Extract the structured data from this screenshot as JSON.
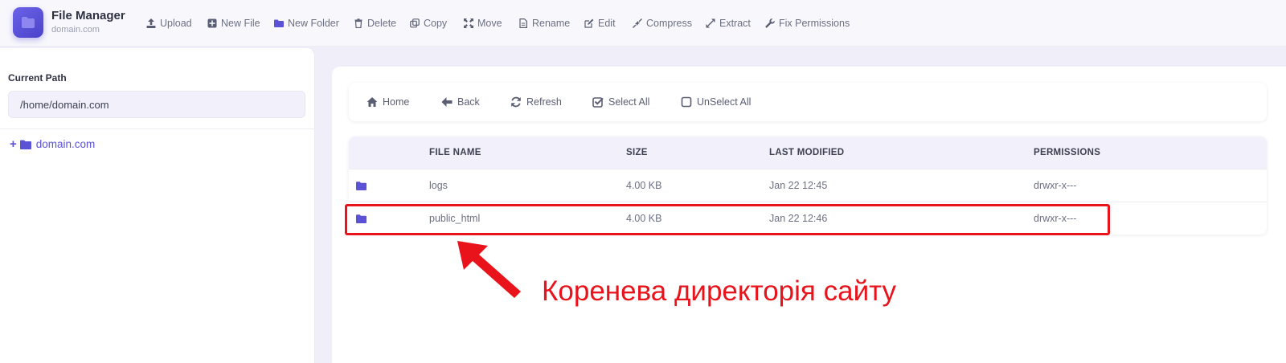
{
  "app": {
    "title": "File Manager",
    "subtitle": "domain.com",
    "accent_color": "#5b52d6"
  },
  "toolbar": [
    {
      "label": "Upload",
      "icon": "upload-icon"
    },
    {
      "label": "New File",
      "icon": "new-file-icon"
    },
    {
      "label": "New Folder",
      "icon": "new-folder-icon"
    },
    {
      "label": "Delete",
      "icon": "trash-icon"
    },
    {
      "label": "Copy",
      "icon": "copy-icon"
    },
    {
      "label": "Move",
      "icon": "move-icon"
    },
    {
      "label": "Rename",
      "icon": "rename-icon"
    },
    {
      "label": "Edit",
      "icon": "edit-icon"
    },
    {
      "label": "Compress",
      "icon": "compress-icon"
    },
    {
      "label": "Extract",
      "icon": "extract-icon"
    },
    {
      "label": "Fix Permissions",
      "icon": "wrench-icon"
    }
  ],
  "sidebar": {
    "current_path_label": "Current Path",
    "current_path_value": "/home/domain.com",
    "tree": [
      {
        "label": "domain.com",
        "icon": "folder-icon"
      }
    ]
  },
  "nav": [
    {
      "label": "Home",
      "icon": "home-icon"
    },
    {
      "label": "Back",
      "icon": "back-arrow-icon"
    },
    {
      "label": "Refresh",
      "icon": "refresh-icon"
    },
    {
      "label": "Select All",
      "icon": "checked-box-icon"
    },
    {
      "label": "UnSelect All",
      "icon": "empty-box-icon"
    }
  ],
  "table": {
    "columns": [
      "FILE NAME",
      "SIZE",
      "LAST MODIFIED",
      "PERMISSIONS"
    ],
    "rows": [
      {
        "name": "logs",
        "size": "4.00 KB",
        "modified": "Jan 22 12:45",
        "permissions": "drwxr-x---"
      },
      {
        "name": "public_html",
        "size": "4.00 KB",
        "modified": "Jan 22 12:46",
        "permissions": "drwxr-x---"
      }
    ]
  },
  "annotation": {
    "caption": "Коренева директорія сайту",
    "color": "#e8131b"
  }
}
